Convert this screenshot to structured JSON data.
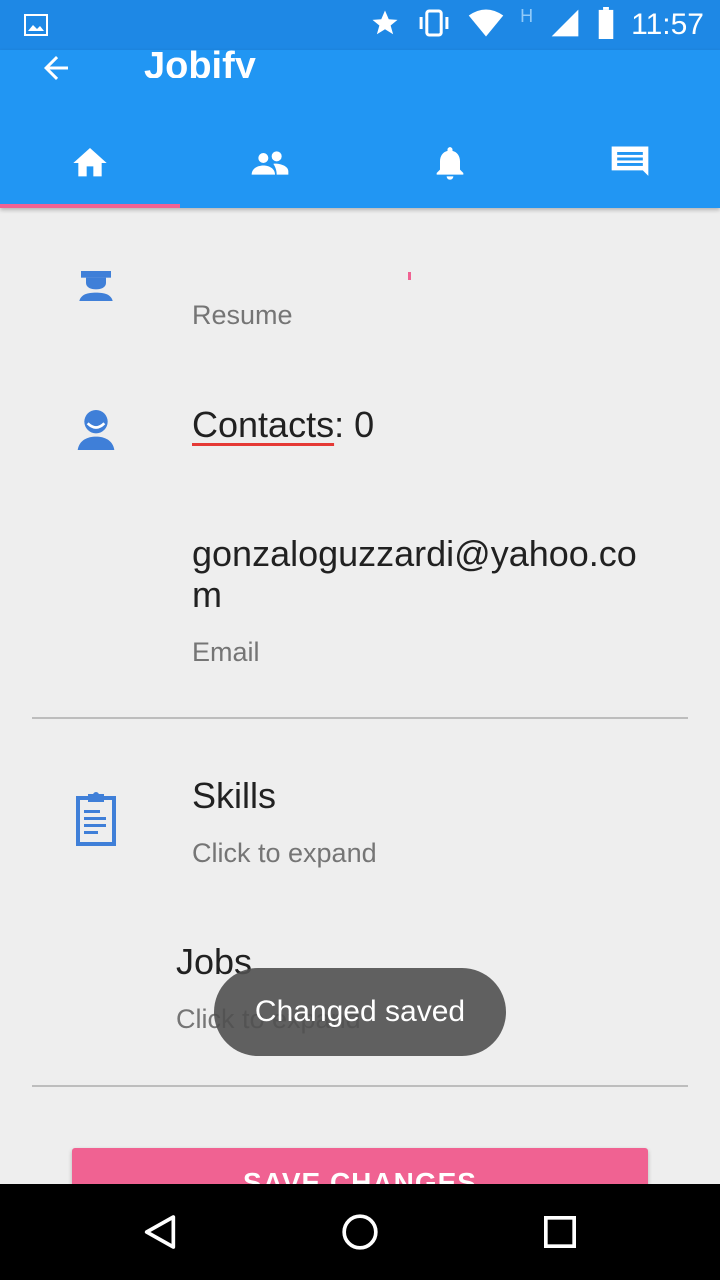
{
  "status_bar": {
    "time": "11:57",
    "network_label": "H",
    "icons": [
      "image-icon",
      "star-icon",
      "vibrate-icon",
      "wifi-icon",
      "signal-icon",
      "battery-icon"
    ]
  },
  "app_bar": {
    "title": "Jobify",
    "tabs": [
      {
        "icon": "home-icon",
        "active": true
      },
      {
        "icon": "people-icon",
        "active": false
      },
      {
        "icon": "bell-icon",
        "active": false
      },
      {
        "icon": "message-icon",
        "active": false
      }
    ]
  },
  "profile": {
    "resume_value": "",
    "resume_label": "Resume",
    "contacts_label": "Contacts",
    "contacts_count": ": 0",
    "email_value": "gonzaloguzzardi@yahoo.com",
    "email_label": "Email"
  },
  "skills": {
    "title": "Skills",
    "subtitle": "Click to expand"
  },
  "jobs": {
    "title": "Jobs",
    "subtitle": "Click to expand"
  },
  "save_button": "SAVE CHANGES",
  "toast": "Changed saved",
  "colors": {
    "primary": "#2196f3",
    "status_bar": "#1e88e5",
    "accent": "#f06292",
    "icon_blue": "#3f7fd8"
  }
}
